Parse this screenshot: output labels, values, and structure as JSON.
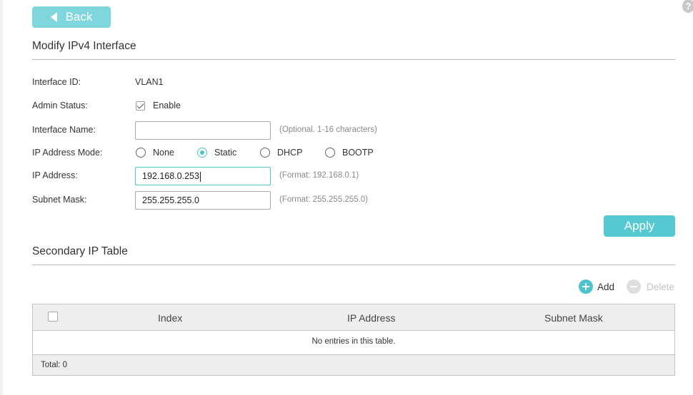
{
  "nav": {
    "back_label": "Back",
    "help_glyph": "?"
  },
  "modify_section": {
    "title": "Modify IPv4 Interface",
    "interface_id_label": "Interface ID:",
    "interface_id_value": "VLAN1",
    "admin_status_label": "Admin Status:",
    "admin_status_enable_label": "Enable",
    "admin_status_checked": true,
    "interface_name_label": "Interface Name:",
    "interface_name_value": "",
    "interface_name_hint": "(Optional. 1-16 characters)",
    "ip_mode_label": "IP Address Mode:",
    "ip_modes": [
      {
        "label": "None",
        "checked": false
      },
      {
        "label": "Static",
        "checked": true
      },
      {
        "label": "DHCP",
        "checked": false
      },
      {
        "label": "BOOTP",
        "checked": false
      }
    ],
    "ip_address_label": "IP Address:",
    "ip_address_value": "192.168.0.253",
    "ip_address_hint": "(Format: 192.168.0.1)",
    "subnet_mask_label": "Subnet Mask:",
    "subnet_mask_value": "255.255.255.0",
    "subnet_mask_hint": "(Format: 255.255.255.0)",
    "apply_label": "Apply"
  },
  "secondary_section": {
    "title": "Secondary IP Table",
    "add_label": "Add",
    "delete_label": "Delete",
    "columns": [
      "Index",
      "IP Address",
      "Subnet Mask"
    ],
    "empty_message": "No entries in this table.",
    "total_label": "Total: 0"
  },
  "colors": {
    "accent": "#4fc3cc",
    "back_button": "#7fd7dd",
    "apply_button": "#55c9d2",
    "hint": "#8a8a8a"
  }
}
